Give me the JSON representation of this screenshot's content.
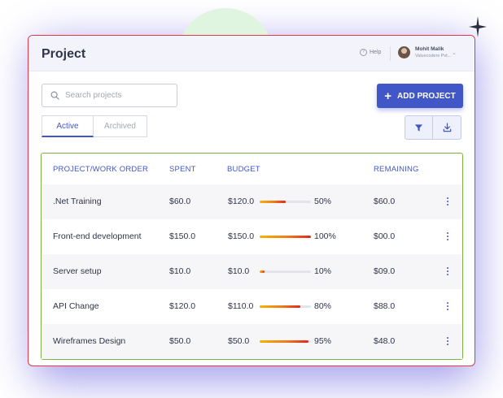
{
  "header": {
    "title": "Project",
    "help_label": "Help",
    "user": {
      "name": "Mohit Malik",
      "org": "Valuecoders Pvt..."
    }
  },
  "toolbar": {
    "search_placeholder": "Search projects",
    "add_button_label": "ADD PROJECT",
    "tabs": [
      {
        "label": "Active",
        "active": true
      },
      {
        "label": "Archived",
        "active": false
      }
    ]
  },
  "table": {
    "headers": [
      "PROJECT/WORK ORDER",
      "SPENT",
      "BUDGET",
      "REMAINING"
    ],
    "rows": [
      {
        "name": ".Net Training",
        "spent": "$60.0",
        "budget": "$120.0",
        "progress": 50,
        "progress_label": "50%",
        "remaining": "$60.0"
      },
      {
        "name": "Front-end development",
        "spent": "$150.0",
        "budget": "$150.0",
        "progress": 100,
        "progress_label": "100%",
        "remaining": "$00.0"
      },
      {
        "name": "Server setup",
        "spent": "$10.0",
        "budget": "$10.0",
        "progress": 10,
        "progress_label": "10%",
        "remaining": "$09.0"
      },
      {
        "name": "API Change",
        "spent": "$120.0",
        "budget": "$110.0",
        "progress": 80,
        "progress_label": "80%",
        "remaining": "$88.0"
      },
      {
        "name": "Wireframes Design",
        "spent": "$50.0",
        "budget": "$50.0",
        "progress": 95,
        "progress_label": "95%",
        "remaining": "$48.0"
      }
    ]
  },
  "colors": {
    "accent": "#4157c8",
    "card_border": "#e0384a",
    "table_border": "#7cb342",
    "progress_start": "#f5b400",
    "progress_end": "#e0261f"
  },
  "icons": [
    "search-icon",
    "plus-icon",
    "filter-icon",
    "download-icon",
    "help-icon",
    "chevron-down-icon",
    "more-vertical-icon",
    "sparkle-icon"
  ]
}
